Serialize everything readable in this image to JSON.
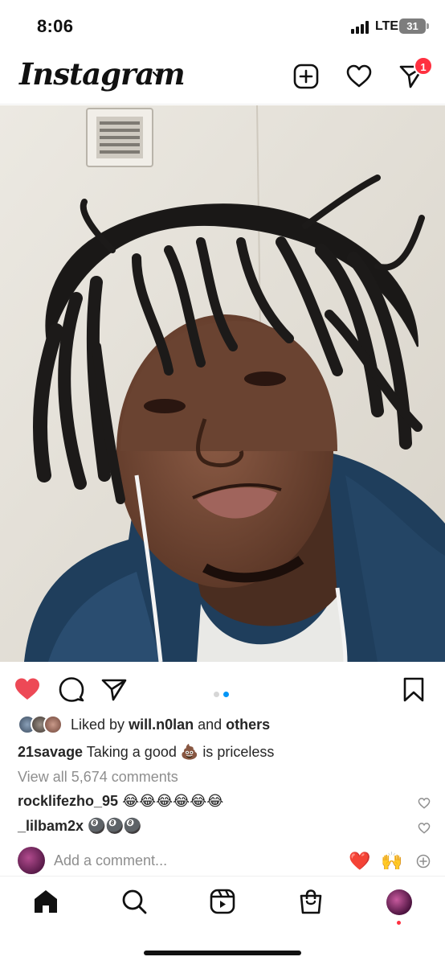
{
  "status_bar": {
    "time": "8:06",
    "network": "LTE",
    "battery": "31"
  },
  "header": {
    "logo": "Instagram",
    "dm_badge": "1",
    "icons": [
      "chevron-down-icon",
      "new-post-icon",
      "heart-icon",
      "direct-message-icon"
    ]
  },
  "post": {
    "carousel_total": 2,
    "carousel_active": 2,
    "liked": true,
    "like_color": "#ed4956",
    "accent_dot_color": "#0095f6",
    "likes": {
      "prefix": "Liked by",
      "user": "will.n0lan",
      "joiner": "and",
      "others": "others"
    },
    "caption": {
      "username": "21savage",
      "text_before": "Taking a good",
      "emoji": "💩",
      "text_after": "is priceless"
    },
    "view_all": "View all 5,674 comments",
    "comments": [
      {
        "username": "rocklifezho_95",
        "text": "😂😂😂😂😂😂"
      },
      {
        "username": "_lilbam2x",
        "text": "🎱🎱🎱"
      }
    ],
    "add_comment_placeholder": "Add a comment...",
    "quick_reactions": [
      "❤️",
      "🙌"
    ]
  },
  "bottom_nav": {
    "items": [
      "home-icon",
      "search-icon",
      "reels-icon",
      "shop-icon",
      "profile-avatar"
    ]
  }
}
